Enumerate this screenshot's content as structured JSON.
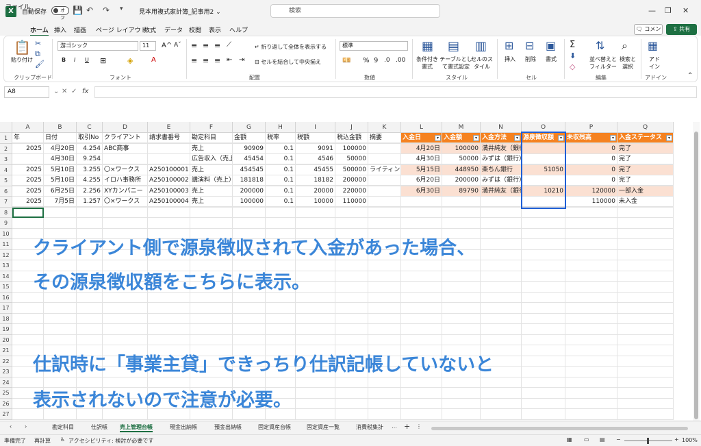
{
  "titlebar": {
    "autosave_label": "自動保存",
    "autosave_state": "オフ",
    "doc_title": "見本用複式家計簿_記事用2 ⌄",
    "search_placeholder": "検索"
  },
  "menu": [
    "ファイル",
    "ホーム",
    "挿入",
    "描画",
    "ページ レイアウト",
    "数式",
    "データ",
    "校閲",
    "表示",
    "ヘルプ"
  ],
  "menu_active": "ホーム",
  "comment_label": "コメント",
  "share_label": "共有",
  "ribbon": {
    "paste": "貼り付け",
    "clipboard": "クリップボード",
    "font_name": "游ゴシック",
    "font_size": "11",
    "font": "フォント",
    "wrap": "折り返して全体を表示する",
    "merge": "セルを結合して中央揃え",
    "alignment": "配置",
    "number_format": "標準",
    "number": "数値",
    "cond_format": "条件付き書式",
    "table_format": "テーブルとして書式設定",
    "cell_style": "セルのスタイル",
    "style": "スタイル",
    "insert": "挿入",
    "delete": "削除",
    "format": "書式",
    "cells": "セル",
    "sort_filter": "並べ替えとフィルター",
    "find_select": "検索と選択",
    "editing": "編集",
    "addins": "アドイン",
    "addins_group": "アドイン"
  },
  "namebox": "A8",
  "columns": [
    "A",
    "B",
    "C",
    "D",
    "E",
    "F",
    "G",
    "H",
    "I",
    "J",
    "K",
    "L",
    "M",
    "N",
    "O",
    "P",
    "Q"
  ],
  "rows": [
    "1",
    "2",
    "3",
    "4",
    "5",
    "6",
    "7",
    "8",
    "9",
    "10",
    "11",
    "12",
    "13",
    "14",
    "15",
    "16",
    "17",
    "18",
    "19",
    "20",
    "21",
    "22",
    "23",
    "24",
    "25",
    "26",
    "27"
  ],
  "table_headers": [
    "年",
    "日付",
    "取引No",
    "クライアント",
    "請求書番号",
    "勘定科目",
    "金額",
    "税率",
    "税額",
    "税込金額",
    "摘要"
  ],
  "table_rows": [
    [
      "2025",
      "4月20日",
      "4.254",
      "ABC商事",
      "",
      "売上",
      "90909",
      "0.1",
      "9091",
      "100000",
      ""
    ],
    [
      "",
      "4月30日",
      "9.254",
      "",
      "",
      "広告収入（売上）",
      "45454",
      "0.1",
      "4546",
      "50000",
      ""
    ],
    [
      "2025",
      "5月10日",
      "3.255",
      "〇×ワークス",
      "A250100001",
      "売上",
      "454545",
      "0.1",
      "45455",
      "500000",
      "ライティング"
    ],
    [
      "2025",
      "5月10日",
      "4.255",
      "イロハ事務所",
      "A250100002",
      "講演料（売上）",
      "181818",
      "0.1",
      "18182",
      "200000",
      ""
    ],
    [
      "2025",
      "6月25日",
      "2.256",
      "XYカンパニー",
      "A250100003",
      "売上",
      "200000",
      "0.1",
      "20000",
      "220000",
      ""
    ],
    [
      "2025",
      "7月5日",
      "1.257",
      "〇×ワークス",
      "A250100004",
      "売上",
      "100000",
      "0.1",
      "10000",
      "110000",
      ""
    ]
  ],
  "right_headers": [
    "入金日",
    "入金額",
    "入金方法",
    "源泉徴収額",
    "未収残高",
    "入金ステータス"
  ],
  "right_rows": [
    [
      "4月20日",
      "100000",
      "満井純友（銀行）",
      "",
      "0",
      "完了"
    ],
    [
      "4月30日",
      "50000",
      "みずは（銀行）",
      "",
      "0",
      "完了"
    ],
    [
      "5月15日",
      "448950",
      "楽ちん銀行",
      "51050",
      "0",
      "完了"
    ],
    [
      "6月20日",
      "200000",
      "みずは（銀行）",
      "",
      "0",
      "完了"
    ],
    [
      "6月30日",
      "89790",
      "満井純友（銀行）",
      "10210",
      "120000",
      "一部入金"
    ],
    [
      "",
      "",
      "",
      "",
      "110000",
      "未入金"
    ]
  ],
  "annotation": {
    "line1": "クライアント側で源泉徴収されて入金があった場合、",
    "line2": "その源泉徴収額をこちらに表示。",
    "line3": "仕訳時に「事業主貸」できっちり仕訳記帳していないと",
    "line4": "表示されないので注意が必要。"
  },
  "sheet_tabs": [
    "勘定科目",
    "仕訳帳",
    "売上管理台帳",
    "現金出納帳",
    "預金出納帳",
    "固定資産台帳",
    "固定資産一覧",
    "消費税集計"
  ],
  "active_tab": "売上管理台帳",
  "status": {
    "ready": "準備完了",
    "recalc": "再計算",
    "accessibility": "アクセシビリティ: 検討が必要です",
    "zoom": "100%"
  },
  "colors": {
    "accent": "#1d6f42",
    "orange": "#f58220",
    "peach": "#fbe0d2",
    "annotation": "#3b86d8",
    "highlight": "#1f5fd6"
  }
}
